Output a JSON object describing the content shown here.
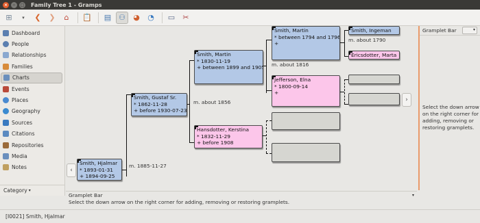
{
  "window": {
    "title": "Family Tree 1 - Gramps"
  },
  "sidebar": {
    "items": [
      {
        "label": "Dashboard",
        "icon": "dashboard-icon",
        "color": "#5b7fb0"
      },
      {
        "label": "People",
        "icon": "people-icon",
        "color": "#5b7fb0"
      },
      {
        "label": "Relationships",
        "icon": "relationships-icon",
        "color": "#8aa8cf"
      },
      {
        "label": "Families",
        "icon": "families-icon",
        "color": "#d88b3a"
      },
      {
        "label": "Charts",
        "icon": "charts-icon",
        "color": "#6a8fbd"
      },
      {
        "label": "Events",
        "icon": "events-icon",
        "color": "#b94a3a"
      },
      {
        "label": "Places",
        "icon": "places-icon",
        "color": "#4a8ad0"
      },
      {
        "label": "Geography",
        "icon": "geography-icon",
        "color": "#3a8ad0"
      },
      {
        "label": "Sources",
        "icon": "sources-icon",
        "color": "#3a7ac0"
      },
      {
        "label": "Citations",
        "icon": "citations-icon",
        "color": "#5b8ac0"
      },
      {
        "label": "Repositories",
        "icon": "repositories-icon",
        "color": "#9a6a3a"
      },
      {
        "label": "Media",
        "icon": "media-icon",
        "color": "#6a8fbd"
      },
      {
        "label": "Notes",
        "icon": "notes-icon",
        "color": "#c0a060"
      }
    ],
    "category_label": "Category"
  },
  "people": {
    "hjalmar": {
      "name": "Smith, Hjalmar",
      "line1": "* 1893-01-31",
      "line2": "+ 1894-09-25"
    },
    "gustaf": {
      "name": "Smith, Gustaf Sr.",
      "line1": "* 1862-11-28",
      "line2": "+ before 1930-07-23"
    },
    "martin2": {
      "name": "Smith, Martin",
      "line1": "* 1830-11-19",
      "line2": "+ between 1899 and 1905"
    },
    "kerstina": {
      "name": "Hansdotter, Kerstina",
      "line1": "* 1832-11-29",
      "line2": "+ before 1908"
    },
    "martin1": {
      "name": "Smith, Martin",
      "line1": "* between 1794 and 1796",
      "line2": "+"
    },
    "elna": {
      "name": "Jefferson, Elna",
      "line1": "* 1800-09-14",
      "line2": "+"
    },
    "ingeman": {
      "name": "Smith, Ingeman"
    },
    "marta": {
      "name": "Ericsdotter, Marta"
    }
  },
  "marriages": {
    "m1": "m. 1885-11-27",
    "m2": "m. about 1856",
    "m3": "m. about 1816",
    "m4": "m. about 1790"
  },
  "gramplets": {
    "bottom_tab_label": "Gramplet Bar",
    "bottom_message": "Select the down arrow on the right corner for adding, removing or restoring gramplets.",
    "right_header": "Gramplet Bar",
    "right_message": "Select the down arrow on the right corner for adding, removing or restoring gramplets."
  },
  "status": {
    "text": "[I0021] Smith, Hjalmar"
  }
}
